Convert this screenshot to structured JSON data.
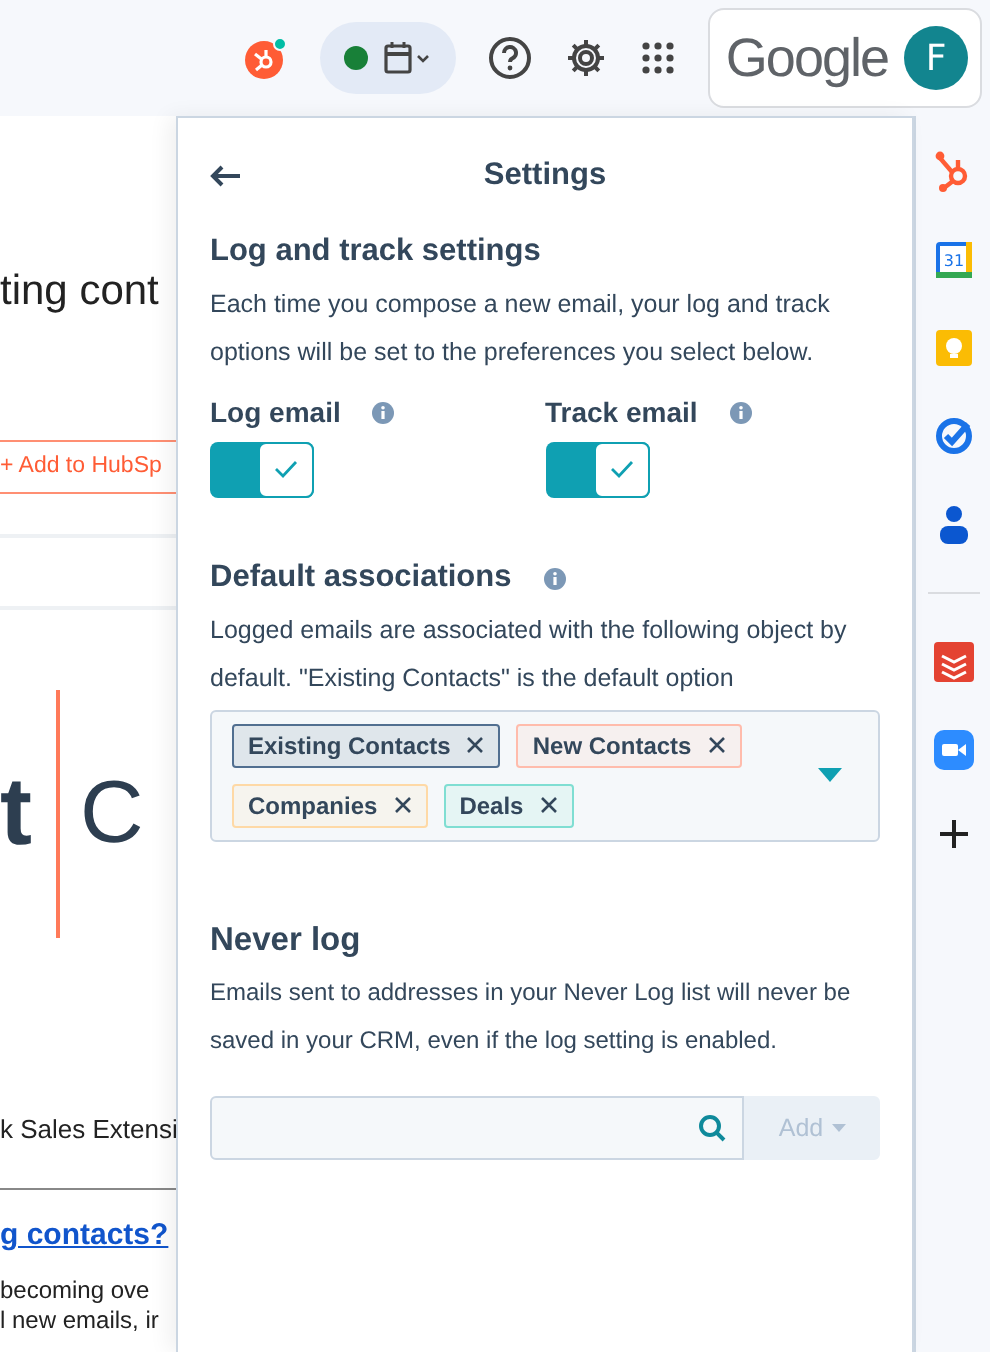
{
  "topbar": {
    "status_online": true,
    "google_label": "Google",
    "avatar_letter": "F"
  },
  "side_panel": {
    "calendar_day": "31"
  },
  "background_page": {
    "heading_fragment": "ting cont",
    "add_button": "+ Add to HubSp",
    "logo_fragment": "t",
    "logo_letters": "C",
    "extension_text": "k Sales Extensi",
    "link_text": "g contacts?",
    "body_lines": [
      "becoming ove",
      "l new emails, ir"
    ]
  },
  "settings": {
    "title": "Settings",
    "log_track": {
      "heading": "Log and track settings",
      "description": "Each time you compose a new email, your log and track options will be set to the preferences you select below.",
      "toggles": [
        {
          "label": "Log email",
          "checked": true
        },
        {
          "label": "Track email",
          "checked": true
        }
      ]
    },
    "associations": {
      "heading": "Default associations",
      "description": "Logged emails are associated with the following object by default. \"Existing Contacts\" is the default option",
      "tags": [
        {
          "label": "Existing Contacts",
          "color": "#516f90"
        },
        {
          "label": "New Contacts",
          "color": "#ffbcac"
        },
        {
          "label": "Companies",
          "color": "#fed9a6"
        },
        {
          "label": "Deals",
          "color": "#7fded2"
        }
      ]
    },
    "never_log": {
      "heading": "Never log",
      "description": "Emails sent to addresses in your Never Log list will never be saved in your CRM, even if the log setting is enabled.",
      "add_button": "Add",
      "add_disabled": true
    }
  }
}
